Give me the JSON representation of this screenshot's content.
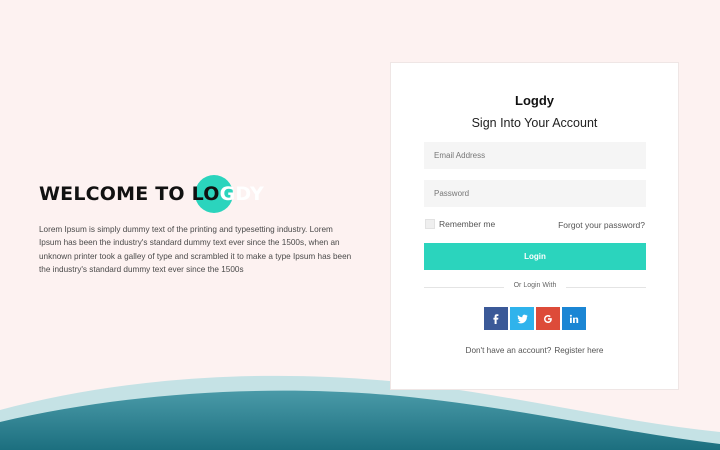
{
  "hero": {
    "title_prefix": "WELCOME TO LO",
    "title_brand": "GDY",
    "description": "Lorem Ipsum is simply dummy text of the printing and typesetting industry. Lorem Ipsum has been the industry's standard dummy text ever since the 1500s, when an unknown printer took a galley of type and scrambled it to make a type Ipsum has been the industry's standard dummy text ever since the 1500s"
  },
  "login": {
    "brand": "Logdy",
    "subtitle": "Sign Into Your Account",
    "email_placeholder": "Email Address",
    "password_placeholder": "Password",
    "remember_label": "Remember me",
    "forgot_link": "Forgot your password?",
    "login_button": "Login",
    "divider_text": "Or Login With",
    "social": [
      {
        "name": "facebook",
        "icon": "facebook-icon"
      },
      {
        "name": "twitter",
        "icon": "twitter-icon"
      },
      {
        "name": "google",
        "icon": "google-icon"
      },
      {
        "name": "linkedin",
        "icon": "linkedin-icon"
      }
    ],
    "signup_prompt": "Don't have an account?",
    "signup_link": "Register here"
  },
  "colors": {
    "background": "#fdf2f1",
    "accent": "#2bd4bd",
    "wave_dark": "#1c6f7f",
    "wave_light": "#9fcdd3"
  }
}
